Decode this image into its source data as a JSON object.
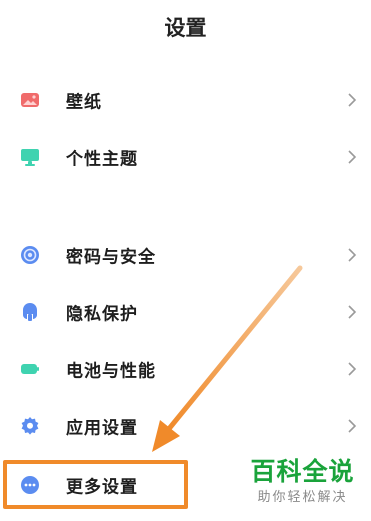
{
  "header": {
    "title": "设置"
  },
  "items": [
    {
      "label": "壁纸",
      "icon": "wallpaper-icon",
      "color": "#f06b6b"
    },
    {
      "label": "个性主题",
      "icon": "theme-icon",
      "color": "#3fd3b0"
    },
    {
      "label": "密码与安全",
      "icon": "lock-icon",
      "color": "#5b8cf0"
    },
    {
      "label": "隐私保护",
      "icon": "privacy-icon",
      "color": "#5b8cf0"
    },
    {
      "label": "电池与性能",
      "icon": "battery-icon",
      "color": "#3fd3b0"
    },
    {
      "label": "应用设置",
      "icon": "gear-icon",
      "color": "#5b8cf0"
    },
    {
      "label": "更多设置",
      "icon": "more-icon",
      "color": "#5b8cf0"
    }
  ],
  "watermark": {
    "main": "百科全说",
    "sub": "助你轻松解决"
  },
  "colors": {
    "highlight": "#f08a2a",
    "watermark": "#1aa33b"
  }
}
